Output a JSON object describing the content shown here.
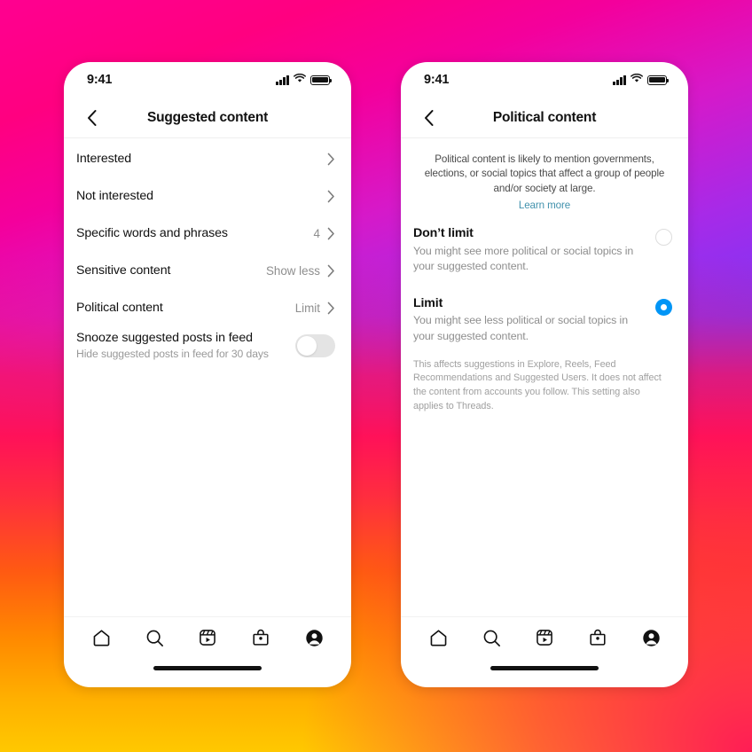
{
  "theme": {
    "accent_blue": "#0095f6",
    "link_blue": "#4292ad",
    "text_primary": "#111111",
    "text_secondary": "#8e8e8e",
    "toggle_off_track": "#e4e4e4",
    "gradient_top_left": "#ff0090",
    "gradient_top_right": "#6f35f5",
    "gradient_bottom_left": "#ffc800",
    "gradient_bottom_right": "#ff1159"
  },
  "status_bar": {
    "time": "9:41",
    "signal_icon": "signal-bars-icon",
    "wifi_icon": "wifi-icon",
    "battery_icon": "battery-full-icon"
  },
  "tab_bar": {
    "items": [
      {
        "name": "home",
        "icon": "home-icon"
      },
      {
        "name": "search",
        "icon": "search-icon"
      },
      {
        "name": "reels",
        "icon": "reels-icon"
      },
      {
        "name": "shop",
        "icon": "shop-bag-icon"
      },
      {
        "name": "profile",
        "icon": "profile-avatar-icon"
      }
    ]
  },
  "left_screen": {
    "back_icon": "chevron-left-icon",
    "title": "Suggested content",
    "rows": [
      {
        "label": "Interested",
        "value": "",
        "sub": "",
        "accessory": "chevron"
      },
      {
        "label": "Not interested",
        "value": "",
        "sub": "",
        "accessory": "chevron"
      },
      {
        "label": "Specific words and phrases",
        "value": "4",
        "sub": "",
        "accessory": "chevron"
      },
      {
        "label": "Sensitive content",
        "value": "Show less",
        "sub": "",
        "accessory": "chevron"
      },
      {
        "label": "Political content",
        "value": "Limit",
        "sub": "",
        "accessory": "chevron"
      },
      {
        "label": "Snooze suggested posts in feed",
        "value": "",
        "sub": "Hide suggested posts in feed for 30 days",
        "accessory": "toggle",
        "toggle_on": false
      }
    ]
  },
  "right_screen": {
    "back_icon": "chevron-left-icon",
    "title": "Political content",
    "description": "Political content is likely to mention governments, elections, or social topics that affect a group of people and/or society at large.",
    "learn_more_label": "Learn more",
    "options": [
      {
        "title": "Don’t limit",
        "desc": "You might see more political or social topics in your suggested content.",
        "selected": false
      },
      {
        "title": "Limit",
        "desc": "You might see less political or social topics in your suggested content.",
        "selected": true
      }
    ],
    "footnote": "This affects suggestions in Explore, Reels, Feed Recommendations and Suggested Users. It does not affect the content from accounts you follow. This setting also applies to Threads."
  }
}
